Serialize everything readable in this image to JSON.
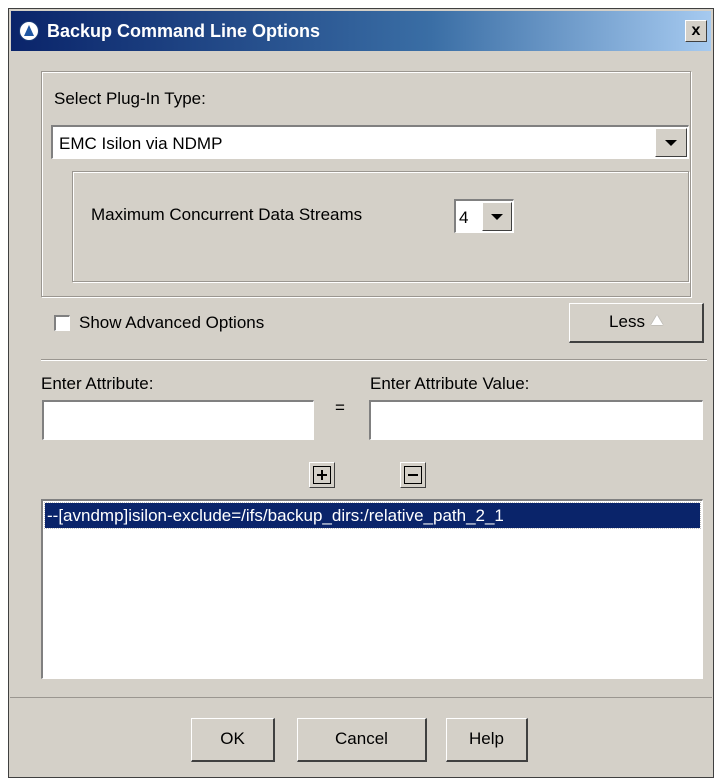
{
  "window": {
    "title": "Backup Command Line Options",
    "close_glyph": "x"
  },
  "plugin": {
    "label": "Select Plug-In Type:",
    "selected": "EMC Isilon via NDMP"
  },
  "streams": {
    "label": "Maximum Concurrent Data Streams",
    "selected": "4"
  },
  "advanced": {
    "checkbox_label": "Show Advanced Options",
    "checked": false,
    "less_label": "Less"
  },
  "attribute": {
    "name_label": "Enter Attribute:",
    "equals": "=",
    "value_label": "Enter Attribute Value:",
    "name_value": "",
    "value_value": ""
  },
  "list": {
    "items": [
      "--[avndmp]isilon-exclude=/ifs/backup_dirs:/relative_path_2_1"
    ],
    "selected_index": 0
  },
  "footer": {
    "ok": "OK",
    "cancel": "Cancel",
    "help": "Help"
  },
  "icons": {
    "app": "app-logo-icon",
    "add": "add-icon",
    "remove": "remove-icon",
    "less_arrow": "triangle-up-icon"
  },
  "colors": {
    "titlebar_start": "#0a246a",
    "titlebar_end": "#a6caf0",
    "dialog_bg": "#d4d0c8",
    "selection_bg": "#0a246a"
  }
}
